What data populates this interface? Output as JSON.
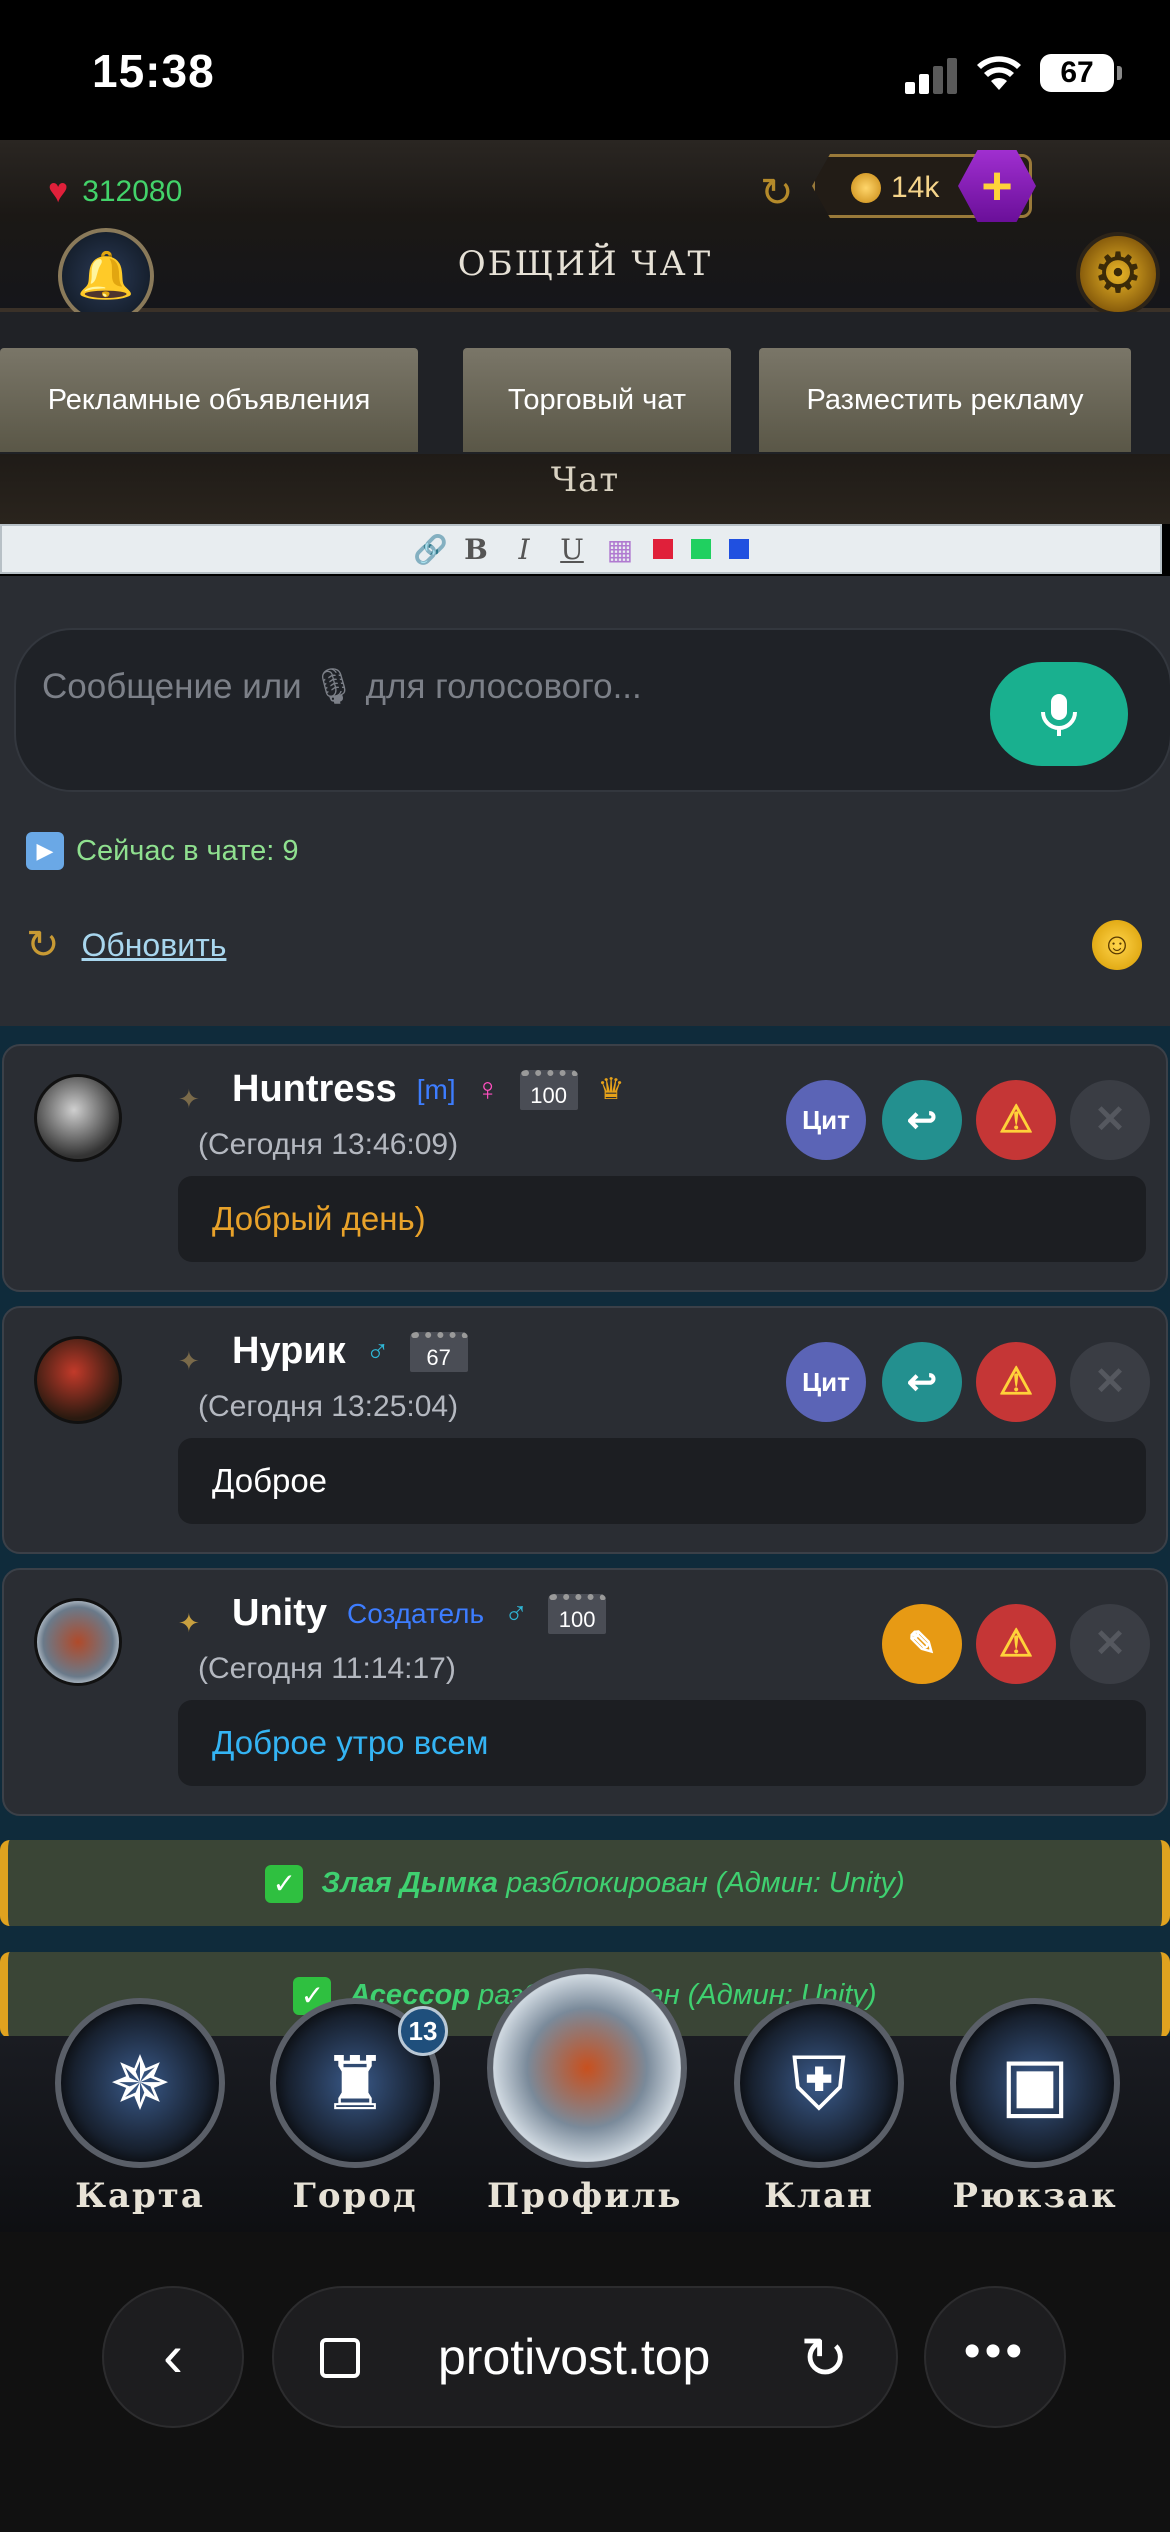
{
  "status_bar": {
    "time": "15:38",
    "battery": "67"
  },
  "header": {
    "hp": "312080",
    "gold": "14k",
    "title": "ОБЩИЙ ЧАТ"
  },
  "tabs": [
    {
      "label": "Рекламные объявления"
    },
    {
      "label": "Торговый чат"
    },
    {
      "label": "Разместить рекламу"
    }
  ],
  "section_title": "Чат",
  "editor_toolbar": {
    "bold": "B",
    "italic": "I",
    "underline": "U",
    "colors": [
      "#e0203a",
      "#20d060",
      "#2050e0"
    ]
  },
  "composer": {
    "placeholder": "Сообщение или 🎙 для голосового...",
    "online": "Сейчас в чате: 9",
    "refresh": "Обновить"
  },
  "messages": [
    {
      "name": "Huntress",
      "tag": "[m]",
      "gender": "♀",
      "level": "100",
      "time": "(Сегодня 13:46:09)",
      "text": "Добрый день)",
      "text_color": "#e8a22a",
      "quote": "Цит"
    },
    {
      "name": "Нурик",
      "gender": "♂",
      "level": "67",
      "time": "(Сегодня 13:25:04)",
      "text": "Доброе",
      "text_color": "#ffffff",
      "quote": "Цит"
    },
    {
      "name": "Unity",
      "tag": "Создатель",
      "gender": "♂",
      "level": "100",
      "time": "(Сегодня 11:14:17)",
      "text": "Доброе утро всем",
      "text_color": "#34b4f4"
    }
  ],
  "system_messages": [
    {
      "user": "Злая Дымка",
      "text": "разблокирован (Админ: Unity)"
    },
    {
      "user": "Асессор",
      "text": "разблокирован (Админ: Unity)"
    }
  ],
  "bottom_nav": {
    "items": [
      {
        "label": "Карта",
        "icon": "compass-icon"
      },
      {
        "label": "Город",
        "icon": "castle-icon"
      },
      {
        "label": "Профиль",
        "icon": "avatar-icon"
      },
      {
        "label": "Клан",
        "icon": "shield-icon"
      },
      {
        "label": "Рюкзак",
        "icon": "backpack-icon"
      }
    ],
    "city_badge": "13"
  },
  "browser": {
    "url": "protivost.top"
  }
}
